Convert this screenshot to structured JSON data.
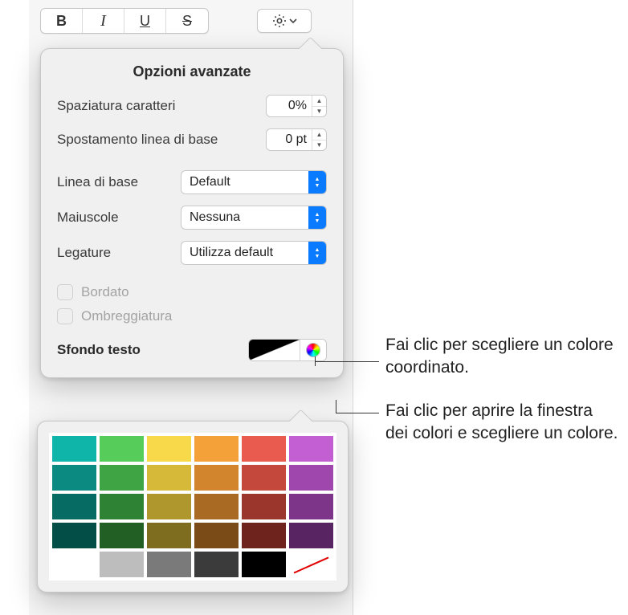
{
  "toolbar": {
    "bold": "B",
    "italic": "I",
    "underline": "U",
    "strike": "S"
  },
  "popover": {
    "title": "Opzioni avanzate",
    "char_spacing_label": "Spaziatura caratteri",
    "char_spacing_value": "0%",
    "baseline_shift_label": "Spostamento linea di base",
    "baseline_shift_value": "0 pt",
    "baseline_label": "Linea di base",
    "baseline_value": "Default",
    "caps_label": "Maiuscole",
    "caps_value": "Nessuna",
    "ligatures_label": "Legature",
    "ligatures_value": "Utilizza default",
    "outline_label": "Bordato",
    "shadow_label": "Ombreggiatura",
    "text_bg_label": "Sfondo testo"
  },
  "swatches": {
    "rows": [
      [
        "#0fb5a8",
        "#56cc5a",
        "#f7d94a",
        "#f4a13a",
        "#ea5b4f",
        "#c45fd3"
      ],
      [
        "#0a8a80",
        "#3fa544",
        "#d7b93a",
        "#d3852e",
        "#c5483d",
        "#9f47ad"
      ],
      [
        "#066b63",
        "#2e8233",
        "#af962d",
        "#a96a23",
        "#9b362d",
        "#7d3589"
      ],
      [
        "#044e48",
        "#215f25",
        "#7e6c1f",
        "#7a4b17",
        "#6e241d",
        "#592462"
      ],
      [
        "#ffffff",
        "#bdbdbd",
        "#7a7a7a",
        "#3b3b3b",
        "#000000",
        "none"
      ]
    ]
  },
  "callouts": {
    "swatch": "Fai clic per scegliere un colore coordinato.",
    "wheel": "Fai clic per aprire la finestra dei colori e scegliere un colore."
  }
}
